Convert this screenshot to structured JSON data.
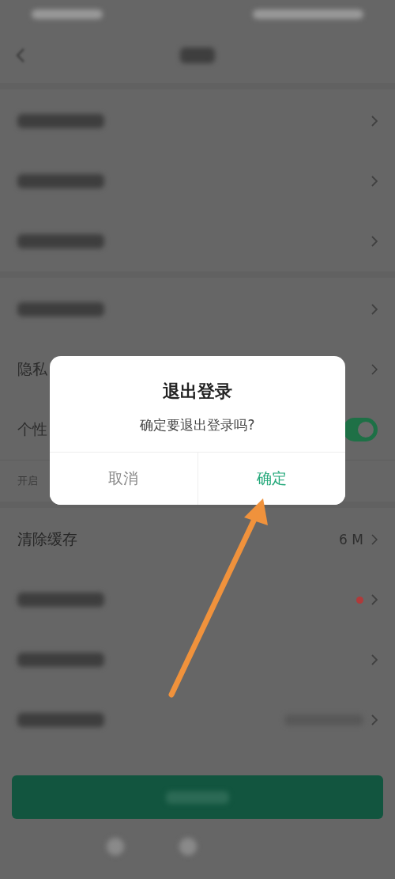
{
  "sections": [
    {
      "rows": [
        {
          "kind": "blurred",
          "badge": false,
          "value_blurred": false
        },
        {
          "kind": "blurred",
          "badge": false,
          "value_blurred": false
        },
        {
          "kind": "blurred",
          "badge": false,
          "value_blurred": false
        }
      ]
    },
    {
      "rows": [
        {
          "kind": "blurred",
          "badge": false,
          "value_blurred": false
        },
        {
          "kind": "link",
          "label": "隐私"
        },
        {
          "kind": "toggle",
          "label": "个性",
          "on": true
        },
        {
          "kind": "note",
          "label": "开启"
        }
      ]
    },
    {
      "rows": [
        {
          "kind": "link",
          "label": "清除缓存",
          "value": "6 M"
        },
        {
          "kind": "blurred",
          "badge": true,
          "value_blurred": false
        },
        {
          "kind": "blurred",
          "badge": false,
          "value_blurred": false
        },
        {
          "kind": "blurred",
          "badge": false,
          "value_blurred": true
        }
      ]
    }
  ],
  "dialog": {
    "title": "退出登录",
    "message": "确定要退出登录吗?",
    "buttons": [
      {
        "label": "取消",
        "kind": "cancel"
      },
      {
        "label": "确定",
        "kind": "confirm"
      }
    ]
  }
}
